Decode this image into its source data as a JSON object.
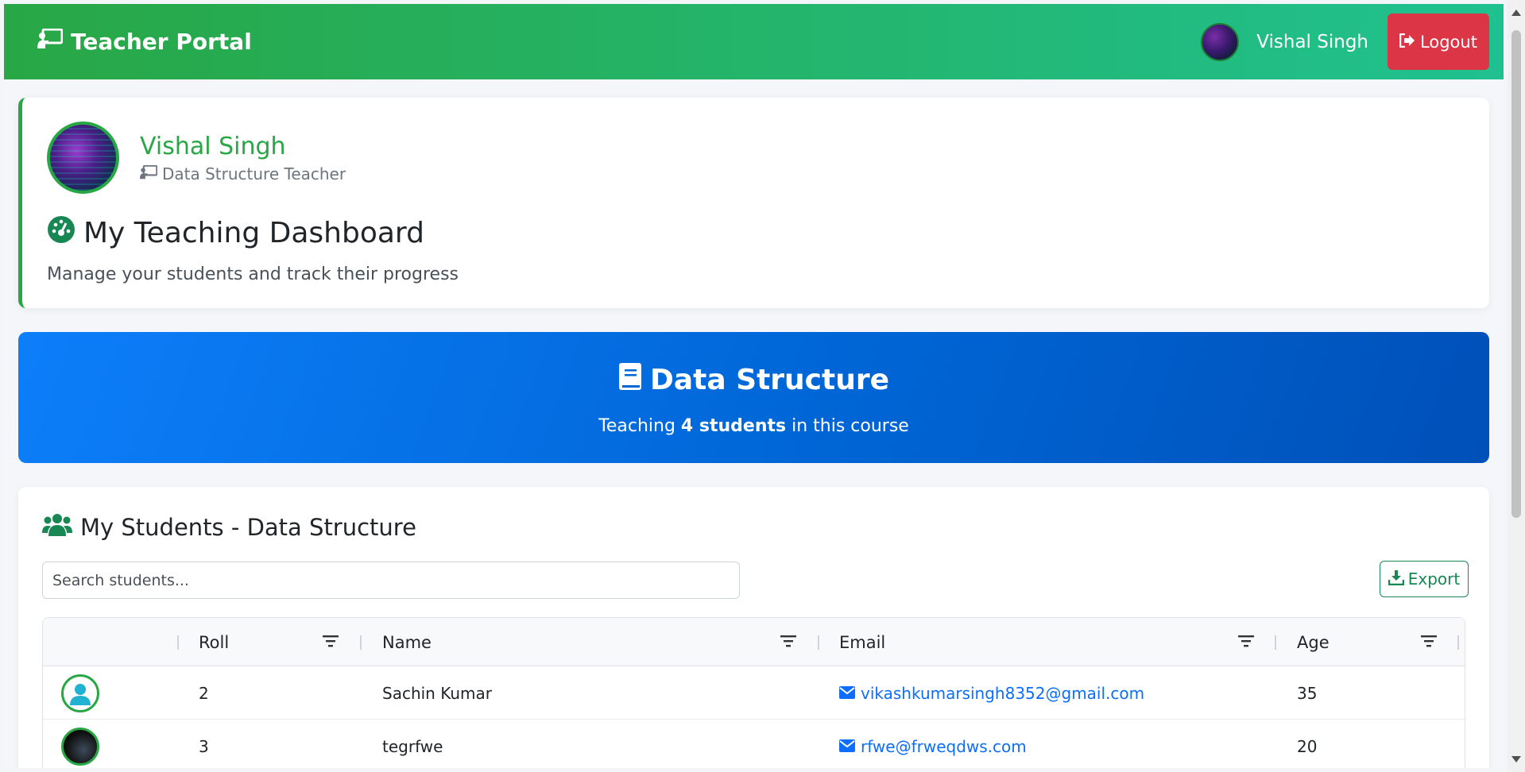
{
  "navbar": {
    "brand": "Teacher Portal",
    "user_name": "Vishal Singh",
    "logout_label": "Logout"
  },
  "profile": {
    "name": "Vishal Singh",
    "role": "Data Structure Teacher",
    "dashboard_title": "My Teaching Dashboard",
    "dashboard_subtitle": "Manage your students and track their progress"
  },
  "course": {
    "title": "Data Structure",
    "sub_prefix": "Teaching ",
    "sub_count": "4 students",
    "sub_suffix": " in this course"
  },
  "students": {
    "title": "My Students - Data Structure",
    "search_placeholder": "Search students...",
    "export_label": "Export",
    "columns": [
      "Roll",
      "Name",
      "Email",
      "Age"
    ],
    "rows": [
      {
        "roll": "2",
        "name": "Sachin Kumar",
        "email": "vikashkumarsingh8352@gmail.com",
        "age": "35",
        "avatar": "default-user-icon"
      },
      {
        "roll": "3",
        "name": "tegrfwe",
        "email": "rfwe@frweqdws.com",
        "age": "20",
        "avatar": "photo"
      }
    ]
  },
  "colors": {
    "primary_green": "#28a745",
    "brand_blue": "#0d6efd",
    "danger_red": "#dc3545"
  }
}
